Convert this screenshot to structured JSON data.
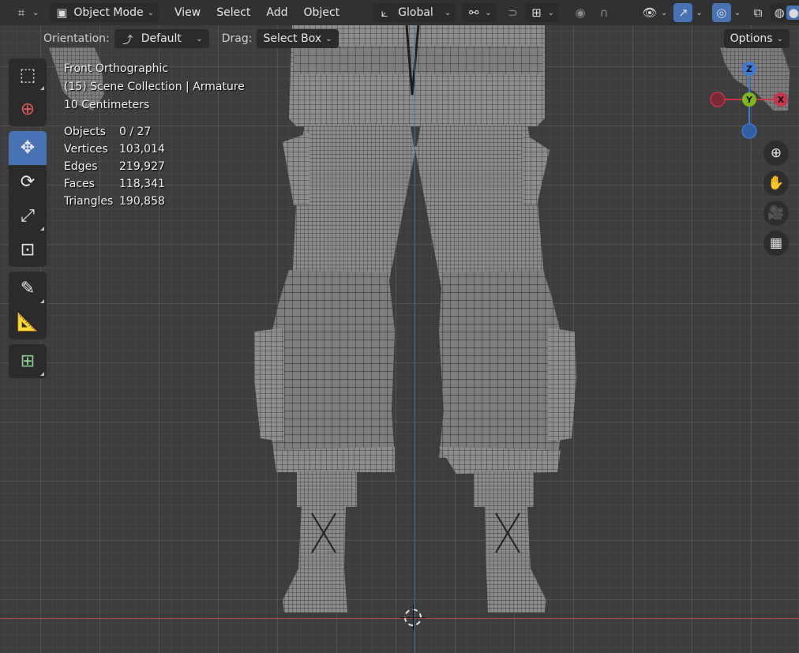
{
  "header": {
    "editor_icon": "editor-type-icon",
    "mode_label": "Object Mode",
    "menus": [
      "View",
      "Select",
      "Add",
      "Object"
    ],
    "transform_orientation": "Global",
    "options_label": "Options"
  },
  "tool_settings": {
    "orientation_label": "Orientation:",
    "orientation_value": "Default",
    "drag_label": "Drag:",
    "drag_value": "Select Box"
  },
  "viewport_info": {
    "view_name": "Front Orthographic",
    "collection": "(15) Scene Collection | Armature",
    "scale": "10 Centimeters"
  },
  "stats": [
    {
      "label": "Objects",
      "value": "0 / 27"
    },
    {
      "label": "Vertices",
      "value": "103,014"
    },
    {
      "label": "Edges",
      "value": "219,927"
    },
    {
      "label": "Faces",
      "value": "118,341"
    },
    {
      "label": "Triangles",
      "value": "190,858"
    }
  ],
  "gizmo": {
    "z": "Z",
    "y": "Y",
    "x": "X"
  },
  "colors": {
    "accent": "#4772b3",
    "x_axis": "#c6354a",
    "y_axis": "#7eb61d",
    "z_axis": "#3e7ad3"
  }
}
